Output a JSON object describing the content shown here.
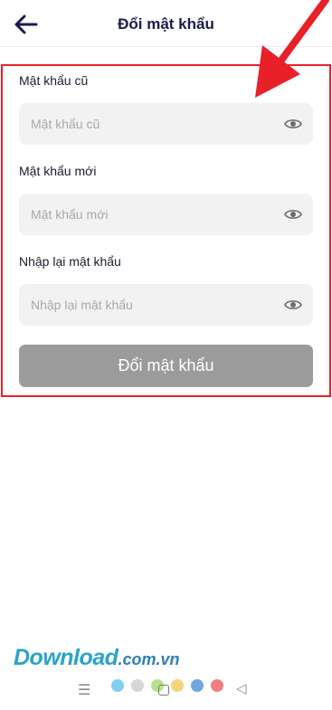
{
  "header": {
    "title": "Đổi mật khẩu",
    "back_icon": "arrow-left-icon"
  },
  "form": {
    "old_password": {
      "label": "Mật khẩu cũ",
      "placeholder": "Mật khẩu cũ",
      "value": ""
    },
    "new_password": {
      "label": "Mật khẩu mới",
      "placeholder": "Mật khẩu mới",
      "value": ""
    },
    "confirm_password": {
      "label": "Nhập lại mật khẩu",
      "placeholder": "Nhập lại mật khẩu",
      "value": ""
    },
    "visibility_icon": "eye-icon",
    "submit_label": "Đổi mật khẩu"
  },
  "annotation": {
    "highlight_color": "#e8202a",
    "arrow_color": "#e8202a"
  },
  "watermark": {
    "main": "Download",
    "suffix": ".com.vn",
    "dot_colors": [
      "#7fd0f0",
      "#d6d6d6",
      "#b8e08a",
      "#f6d27a",
      "#6fa8dc",
      "#f08080"
    ]
  },
  "nav": {
    "menu_icon": "menu-icon",
    "home_icon": "home-icon",
    "back_icon": "back-triangle-icon"
  },
  "colors": {
    "title": "#1b1b4b",
    "input_bg": "#f2f2f2",
    "button_bg": "#9b9b9b"
  }
}
